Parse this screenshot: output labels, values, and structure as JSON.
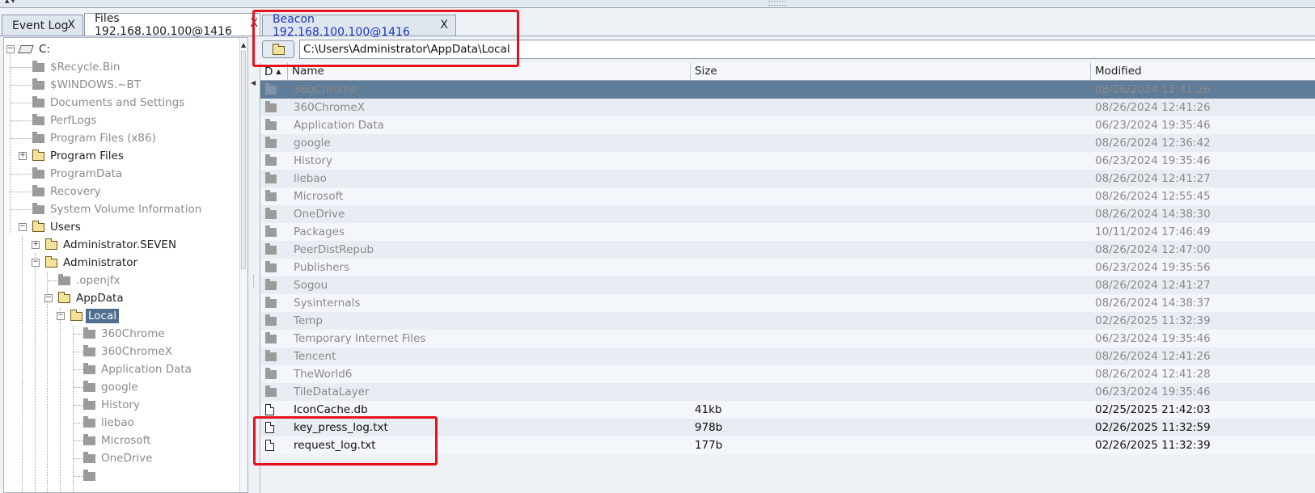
{
  "tabs": [
    {
      "label": "Event Log",
      "close": "X"
    },
    {
      "label": "Files 192.168.100.100@1416",
      "close": "X"
    },
    {
      "label": "Beacon 192.168.100.100@1416",
      "close": "X"
    }
  ],
  "tree": {
    "root": {
      "label": "C:"
    },
    "items": {
      "recycle": "$Recycle.Bin",
      "windows_bt": "$WINDOWS.~BT",
      "docs_settings": "Documents and Settings",
      "perflogs": "PerfLogs",
      "progfiles_x86": "Program Files (x86)",
      "progfiles": "Program Files",
      "programdata": "ProgramData",
      "recovery": "Recovery",
      "sysvolinfo": "System Volume Information",
      "users": "Users",
      "admin_seven": "Administrator.SEVEN",
      "administrator": "Administrator",
      "openjfx": ".openjfx",
      "appdata": "AppData",
      "local": "Local",
      "c360chrome": "360Chrome",
      "c360chromex": "360ChromeX",
      "appdatadir": "Application Data",
      "google": "google",
      "history": "History",
      "liebao": "liebao",
      "microsoft": "Microsoft",
      "onedrive": "OneDrive"
    }
  },
  "path": {
    "value": "C:\\Users\\Administrator\\AppData\\Local"
  },
  "table": {
    "columns": {
      "d": "D",
      "name": "Name",
      "size": "Size",
      "modified": "Modified"
    },
    "rows": [
      {
        "name": "360Chrome",
        "size": "",
        "modified": "08/26/2024 12:41:26"
      },
      {
        "name": "360ChromeX",
        "size": "",
        "modified": "08/26/2024 12:41:26"
      },
      {
        "name": "Application Data",
        "size": "",
        "modified": "06/23/2024 19:35:46"
      },
      {
        "name": "google",
        "size": "",
        "modified": "08/26/2024 12:36:42"
      },
      {
        "name": "History",
        "size": "",
        "modified": "06/23/2024 19:35:46"
      },
      {
        "name": "liebao",
        "size": "",
        "modified": "08/26/2024 12:41:27"
      },
      {
        "name": "Microsoft",
        "size": "",
        "modified": "08/26/2024 12:55:45"
      },
      {
        "name": "OneDrive",
        "size": "",
        "modified": "08/26/2024 14:38:30"
      },
      {
        "name": "Packages",
        "size": "",
        "modified": "10/11/2024 17:46:49"
      },
      {
        "name": "PeerDistRepub",
        "size": "",
        "modified": "08/26/2024 12:47:00"
      },
      {
        "name": "Publishers",
        "size": "",
        "modified": "06/23/2024 19:35:56"
      },
      {
        "name": "Sogou",
        "size": "",
        "modified": "08/26/2024 12:41:27"
      },
      {
        "name": "Sysinternals",
        "size": "",
        "modified": "08/26/2024 14:38:37"
      },
      {
        "name": "Temp",
        "size": "",
        "modified": "02/26/2025 11:32:39"
      },
      {
        "name": "Temporary Internet Files",
        "size": "",
        "modified": "06/23/2024 19:35:46"
      },
      {
        "name": "Tencent",
        "size": "",
        "modified": "08/26/2024 12:41:26"
      },
      {
        "name": "TheWorld6",
        "size": "",
        "modified": "08/26/2024 12:41:28"
      },
      {
        "name": "TileDataLayer",
        "size": "",
        "modified": "06/23/2024 19:35:46"
      },
      {
        "name": "IconCache.db",
        "size": "41kb",
        "modified": "02/25/2025 21:42:03"
      },
      {
        "name": "key_press_log.txt",
        "size": "978b",
        "modified": "02/26/2025 11:32:59"
      },
      {
        "name": "request_log.txt",
        "size": "177b",
        "modified": "02/26/2025 11:32:39"
      }
    ]
  },
  "colors": {
    "selection": "#5f7c99",
    "highlight": "#e8121c",
    "beacon_tab_text": "#1734c4"
  }
}
